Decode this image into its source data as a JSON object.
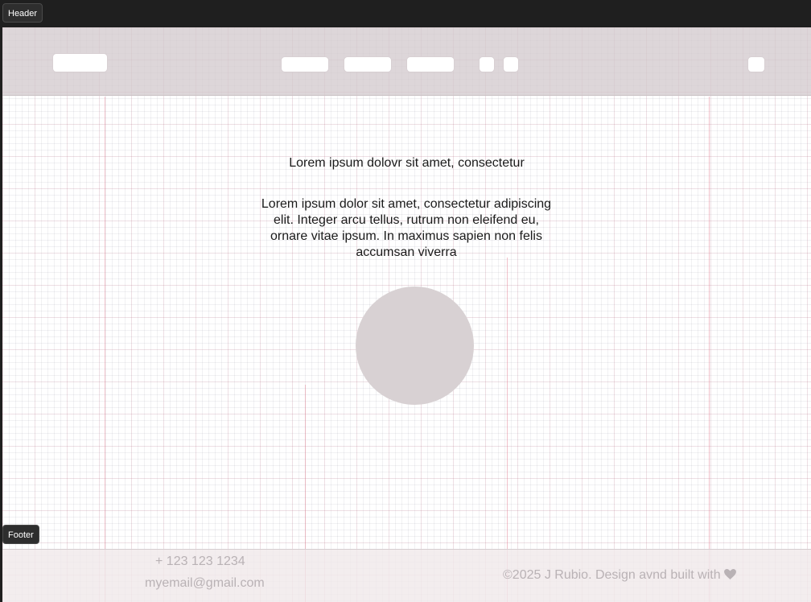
{
  "labels": {
    "header": "Header",
    "footer": "Footer"
  },
  "hero": {
    "title": "Lorem ipsum dolovr sit amet, consectetur",
    "paragraph": "Lorem ipsum dolor sit amet, consectetur adipiscing elit. Integer arcu tellus, rutrum non eleifend eu, ornare vitae ipsum. In maximus sapien non felis accumsan viverra"
  },
  "footer": {
    "phone": "+ 123 123 1234",
    "email": "myemail@gmail.com",
    "copyright": "©2025 J Rubio. Design avnd built with",
    "heart_icon": "heart-icon"
  }
}
